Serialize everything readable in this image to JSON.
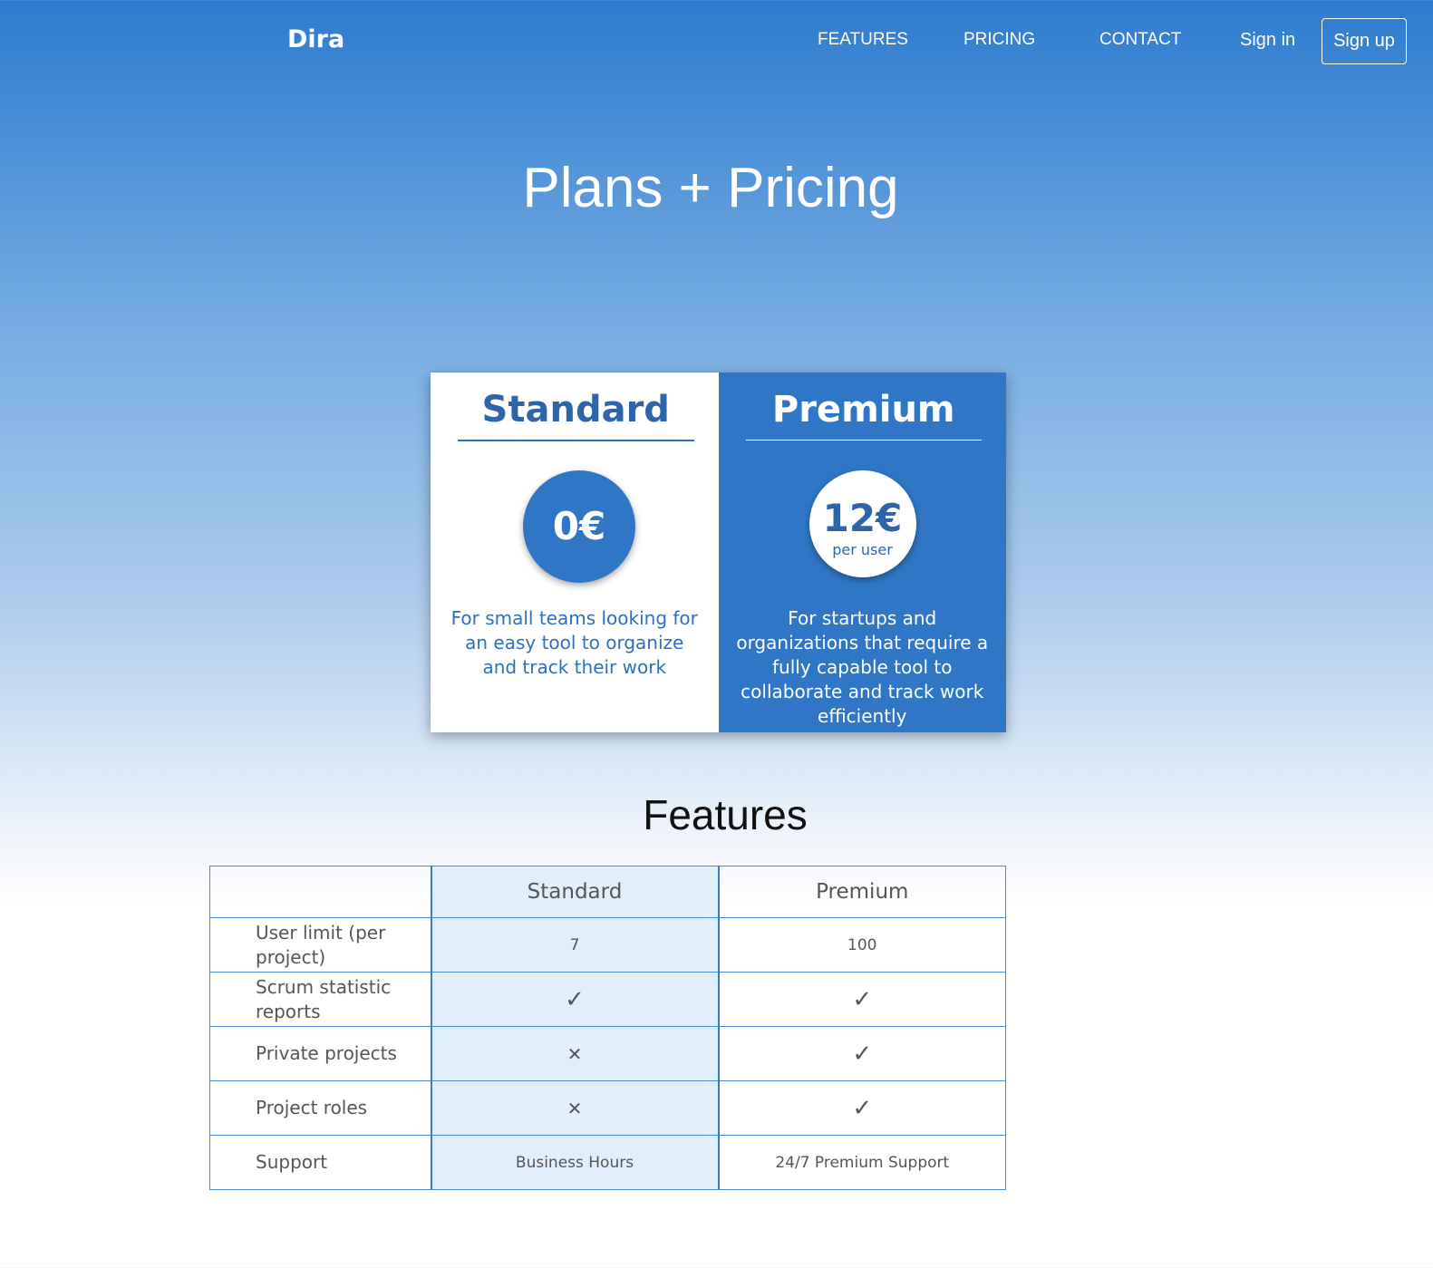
{
  "nav": {
    "brand": "Dira",
    "features": "FEATURES",
    "pricing": "PRICING",
    "contact": "CONTACT",
    "sign_in": "Sign in",
    "sign_up": "Sign up"
  },
  "hero": {
    "title": "Plans + Pricing"
  },
  "plans": [
    {
      "name": "Standard",
      "price": "0€",
      "unit": "",
      "description": "For small teams looking for an easy tool to organize and track their work"
    },
    {
      "name": "Premium",
      "price": "12€",
      "unit": "per user",
      "description": "For startups and organizations that require a fully capable tool to collaborate and track work efficiently"
    }
  ],
  "features": {
    "title": "Features",
    "columns": [
      "",
      "Standard",
      "Premium"
    ],
    "rows": [
      {
        "name": "User limit (per project)",
        "standard": "7",
        "premium": "100"
      },
      {
        "name": "Scrum statistic reports",
        "standard": "✓",
        "premium": "✓"
      },
      {
        "name": "Private projects",
        "standard": "✕",
        "premium": "✓"
      },
      {
        "name": "Project roles",
        "standard": "✕",
        "premium": "✓"
      },
      {
        "name": "Support",
        "standard": "Business Hours",
        "premium": "24/7 Premium Support"
      }
    ]
  },
  "icons": {
    "check": "check-icon",
    "cross": "cross-icon"
  },
  "colors": {
    "primary": "#2f77c6",
    "highlight_column": "#e1eefc"
  }
}
